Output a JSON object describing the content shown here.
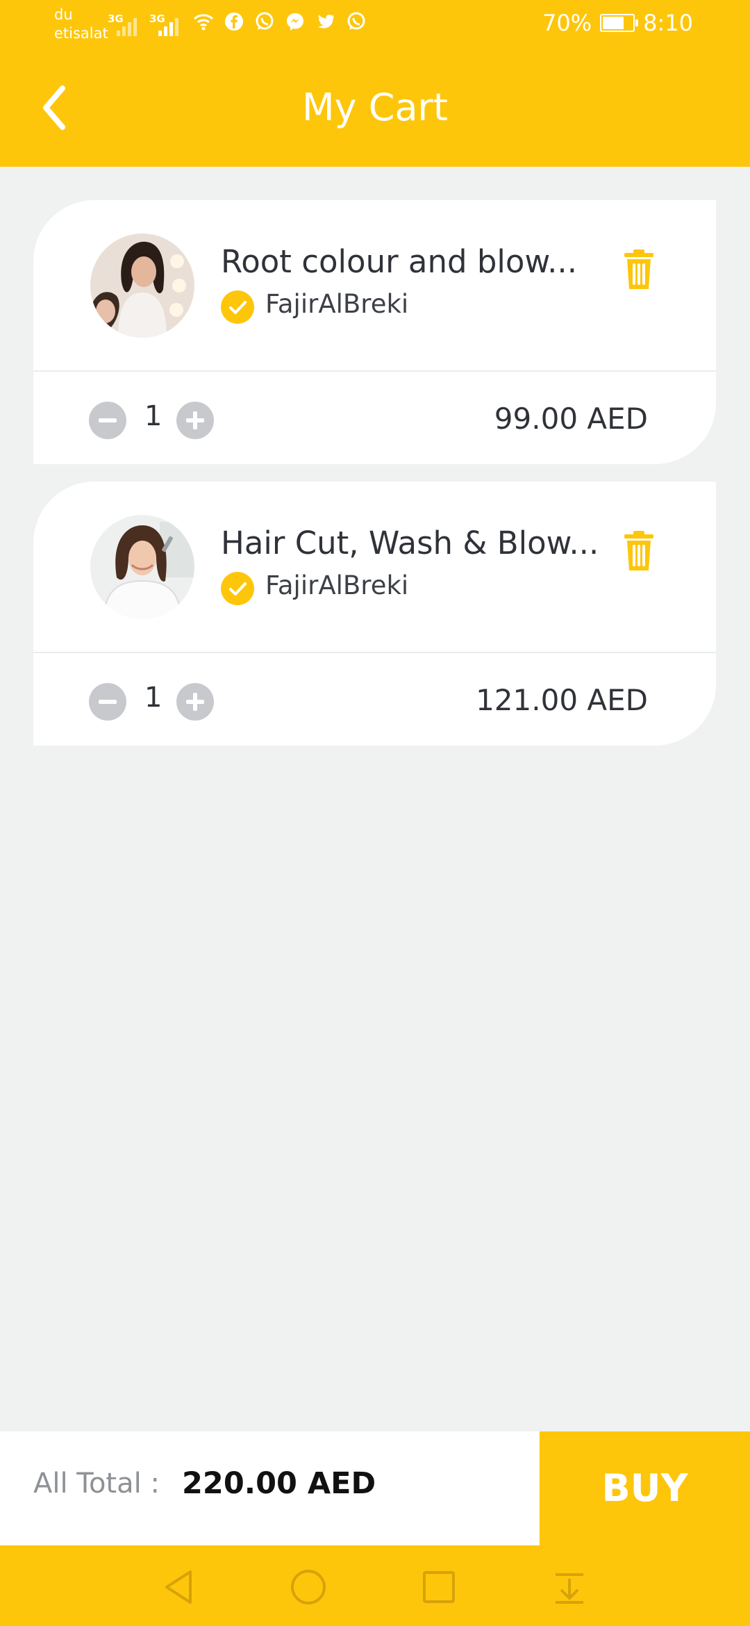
{
  "status_bar": {
    "carrier_1": "du",
    "carrier_2": "etisalat",
    "network_1": "3G",
    "network_2": "3G",
    "notification_icons": [
      "wifi-icon",
      "facebook-icon",
      "whatsapp-icon",
      "messenger-icon",
      "twitter-icon",
      "whatsapp-icon"
    ],
    "battery_percent": "70%",
    "battery_level": 0.7,
    "time": "8:10"
  },
  "app_bar": {
    "back_icon": "chevron-left-icon",
    "title": "My Cart"
  },
  "cart": {
    "items": [
      {
        "title": "Root colour and blow...",
        "seller": "FajirAlBreki",
        "verified_icon": "check-circle-icon",
        "quantity": "1",
        "price": "99.00 AED",
        "delete_icon": "trash-icon",
        "decrement_icon": "minus-circle-icon",
        "increment_icon": "plus-circle-icon"
      },
      {
        "title": "Hair Cut, Wash & Blow...",
        "seller": "FajirAlBreki",
        "verified_icon": "check-circle-icon",
        "quantity": "1",
        "price": "121.00 AED",
        "delete_icon": "trash-icon",
        "decrement_icon": "minus-circle-icon",
        "increment_icon": "plus-circle-icon"
      }
    ]
  },
  "footer": {
    "total_label": "All Total :",
    "total_value": "220.00 AED",
    "buy_label": "BUY"
  },
  "nav_bar": {
    "icons": [
      "back-triangle-icon",
      "home-circle-icon",
      "recents-square-icon",
      "notification-pull-icon"
    ]
  },
  "colors": {
    "accent": "#fec60b",
    "background": "#f0f1f1",
    "card": "#ffffff",
    "text_dark": "#2f3238",
    "qty_button": "#c7c9cd"
  }
}
